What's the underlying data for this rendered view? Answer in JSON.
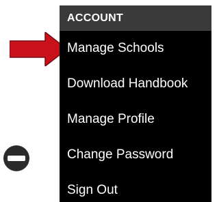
{
  "menu": {
    "header": "ACCOUNT",
    "items": [
      {
        "label": "Manage Schools"
      },
      {
        "label": "Download Handbook"
      },
      {
        "label": "Manage Profile"
      },
      {
        "label": "Change Password"
      },
      {
        "label": "Sign Out"
      }
    ]
  },
  "annotation": {
    "arrow_icon": "red-arrow-right-icon",
    "arrow_color": "#c8111a"
  },
  "side_icon": {
    "icon": "minus-circle-icon",
    "color": "#2b2b2b"
  }
}
